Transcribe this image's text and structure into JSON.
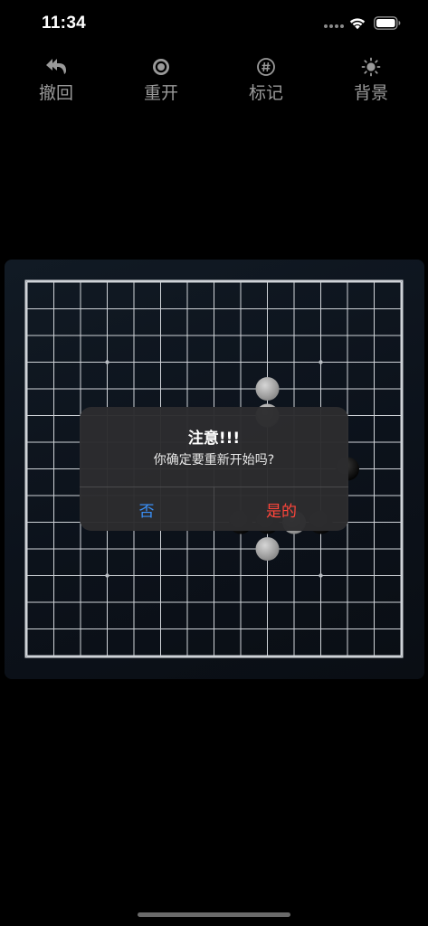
{
  "status_bar": {
    "time": "11:34",
    "icons": [
      "signal-dots-icon",
      "wifi-icon",
      "battery-icon"
    ]
  },
  "toolbar": {
    "undo_label": "撤回",
    "restart_label": "重开",
    "mark_label": "标记",
    "background_label": "背景",
    "icons": [
      "undo-icon",
      "restart-icon",
      "mark-icon",
      "background-icon"
    ],
    "color": "#9a9a9a"
  },
  "board": {
    "lines": 15,
    "line_color": "#cfd3d8",
    "background": "#0f1620",
    "star_points": [
      [
        3,
        3
      ],
      [
        3,
        11
      ],
      [
        11,
        3
      ],
      [
        11,
        11
      ]
    ],
    "stones": [
      {
        "color": "white",
        "col": 9,
        "row": 4
      },
      {
        "color": "white",
        "col": 9,
        "row": 5
      },
      {
        "color": "black",
        "col": 12,
        "row": 7
      },
      {
        "color": "black",
        "col": 8,
        "row": 9
      },
      {
        "color": "black",
        "col": 9,
        "row": 9
      },
      {
        "color": "white",
        "col": 10,
        "row": 9
      },
      {
        "color": "black",
        "col": 11,
        "row": 9
      },
      {
        "color": "white",
        "col": 9,
        "row": 10
      }
    ]
  },
  "alert": {
    "title": "注意!!!",
    "message": "你确定要重新开始吗?",
    "no_label": "否",
    "yes_label": "是的",
    "no_color": "#3a8ff5",
    "yes_color": "#ff453a"
  }
}
